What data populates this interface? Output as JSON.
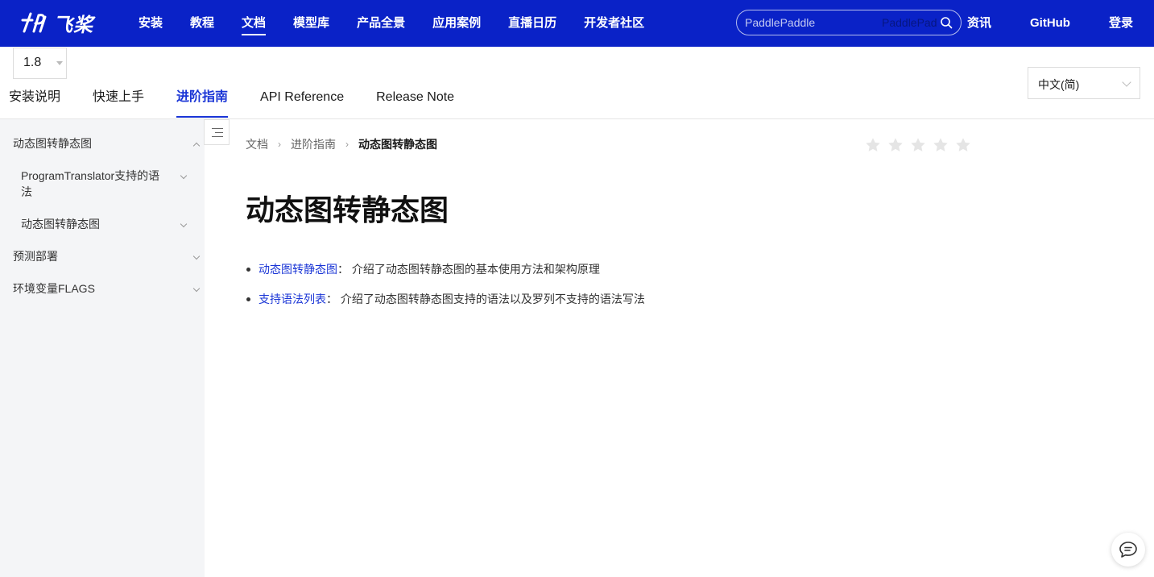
{
  "colors": {
    "brand": "#0a22c7",
    "accent": "#1a35d6",
    "sidebar_bg": "#f4f5f7"
  },
  "header": {
    "logo_text": "飞桨",
    "nav": [
      "安装",
      "教程",
      "文档",
      "模型库",
      "产品全景",
      "应用案例",
      "直播日历",
      "开发者社区"
    ],
    "active_nav": "文档",
    "search": {
      "placeholder": "PaddlePaddle",
      "ghost": "PaddlePad"
    },
    "right_links": [
      "资讯",
      "GitHub",
      "登录"
    ]
  },
  "version": {
    "selected": "1.8"
  },
  "doc_tabs": {
    "items": [
      "安装说明",
      "快速上手",
      "进阶指南",
      "API Reference",
      "Release Note"
    ],
    "active": "进阶指南"
  },
  "language": {
    "selected": "中文(简)"
  },
  "sidebar": {
    "items": [
      {
        "label": "动态图转静态图",
        "level": 1,
        "expanded": true
      },
      {
        "label": "ProgramTranslator支持的语法",
        "level": 2
      },
      {
        "label": "动态图转静态图",
        "level": 2
      },
      {
        "label": "预测部署",
        "level": 1
      },
      {
        "label": "环境变量FLAGS",
        "level": 1
      }
    ]
  },
  "breadcrumb": {
    "items": [
      "文档",
      "进阶指南"
    ],
    "current": "动态图转静态图"
  },
  "rating": {
    "stars": 5,
    "value": 0
  },
  "main": {
    "title": "动态图转静态图",
    "bullets": [
      {
        "link": "动态图转静态图",
        "colon": "：",
        "desc": "介绍了动态图转静态图的基本使用方法和架构原理"
      },
      {
        "link": "支持语法列表",
        "colon": "：",
        "desc": "介绍了动态图转静态图支持的语法以及罗列不支持的语法写法"
      }
    ]
  }
}
